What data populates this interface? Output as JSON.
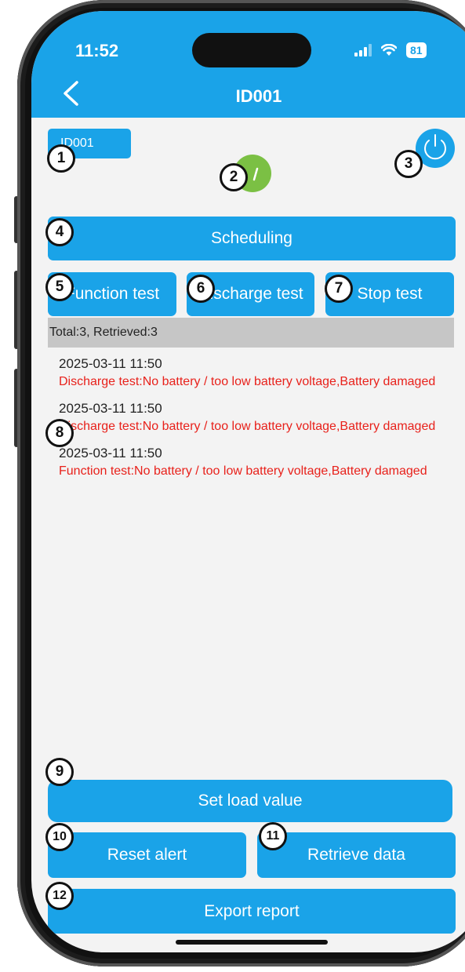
{
  "status_bar": {
    "time": "11:52",
    "battery": "81"
  },
  "header": {
    "title": "ID001"
  },
  "device": {
    "chip_label": "ID001"
  },
  "buttons": {
    "scheduling": "Scheduling",
    "function_test": "Function test",
    "discharge_test": "Discharge test",
    "stop_test": "Stop test",
    "set_load_value": "Set load value",
    "reset_alert": "Reset alert",
    "retrieve_data": "Retrieve data",
    "export_report": "Export report"
  },
  "summary": "Total:3, Retrieved:3",
  "log": [
    {
      "time": "2025-03-11 11:50",
      "message": "Discharge test:No battery / too low battery voltage,Battery damaged"
    },
    {
      "time": "2025-03-11 11:50",
      "message": "Discharge test:No battery / too low battery voltage,Battery damaged"
    },
    {
      "time": "2025-03-11 11:50",
      "message": "Function test:No battery / too low battery voltage,Battery damaged"
    }
  ],
  "markers": [
    "1",
    "2",
    "3",
    "4",
    "5",
    "6",
    "7",
    "8",
    "9",
    "10",
    "11",
    "12"
  ],
  "colors": {
    "accent": "#1aa3e8",
    "ok_status": "#7bc044",
    "error_text": "#e8211b"
  }
}
